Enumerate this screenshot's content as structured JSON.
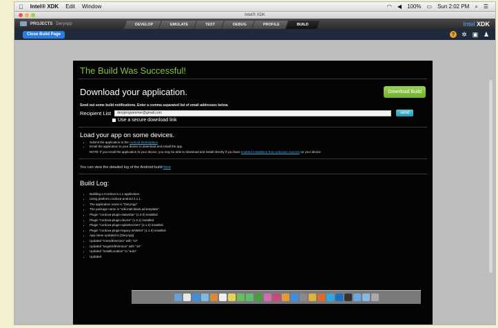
{
  "menubar": {
    "apple": "",
    "app_name": "Intel® XDK",
    "menu": [
      "Edit",
      "Window"
    ],
    "battery": "100%",
    "clock": "Sun 2:02 PM"
  },
  "window": {
    "title": "Intel® XDK"
  },
  "projects": {
    "label": "PROJECTS",
    "name": "DeryApp"
  },
  "tabs": [
    {
      "label": "DEVELOP"
    },
    {
      "label": "EMULATE"
    },
    {
      "label": "TEST"
    },
    {
      "label": "DEBUG"
    },
    {
      "label": "PROFILE"
    },
    {
      "label": "BUILD"
    }
  ],
  "brand": {
    "intel": "Intel",
    "xdk": "XDK"
  },
  "toolbar": {
    "close_label": "Close Build Page"
  },
  "build": {
    "success": "The Build Was Successful!",
    "download_title": "Download your application.",
    "download_button": "Download Build",
    "notify_text": "Send out some build notifications.  Enter a comma separated list of email addresses below.",
    "recipient_label": "Recipient List",
    "recipient_value": "deryprogrammer@gmail.com",
    "send_label": "send",
    "secure_label": "Use a secure download link",
    "load_title": "Load your app on some devices.",
    "step1_pre": "Submit the application to the ",
    "step1_link": "Android Marketplace",
    "step1_post": ".",
    "step2": "Email the application to your device to download and install the app.",
    "note_pre": "NOTE:  If you email the application to your device, you may be able to download and install directly if you have ",
    "note_link": "enabled installation from unknown sources",
    "note_post": " on your device.",
    "log_pre": "You can view the detailed log of the Android build ",
    "log_link": "here",
    "buildlog_title": "Build Log:",
    "log_items": [
      "Building a Cordova 5.1.1 application.",
      "Using platform cordova-android 4.1.1.",
      "The application name is \"DeryApp\"",
      "The package name is \"xdk.intel.blank.ad.template\"",
      "Plugin \"cordova-plugin-statusbar\" (1.0.0) installed.",
      "Plugin \"cordova-plugin-device\" (1.0.1) installed.",
      "Plugin \"cordova-plugin-splashscreen\" (2.1.0) installed.",
      "Plugin \"cordova-plugin-legacy-whitelist\" (1.1.0) installed.",
      "App name updated to [DeryApp]",
      "Updated \"minSdkVersion\" with \"14\"",
      "Updated \"targetSdkVersion\" with \"19\"",
      "Updated \"installLocation\" to \"auto\"",
      "Updated"
    ]
  },
  "colors": {
    "success_green": "#84c33e",
    "download_green": "#7ab834",
    "send_blue": "#3aa7c3",
    "close_blue": "#2e7be0",
    "brand_blue": "#5aa9ff"
  },
  "dock_icons": [
    "finder-icon",
    "launchpad-icon",
    "safari-icon",
    "mail-icon",
    "contacts-icon",
    "calendar-icon",
    "notes-icon",
    "maps-icon",
    "messages-icon",
    "facetime-icon",
    "photo-icon",
    "itunes-icon",
    "ibooks-icon",
    "appstore-icon",
    "preferences-icon",
    "chrome-icon",
    "firefox-icon",
    "skype-icon",
    "xdk-icon",
    "terminal-icon",
    "folder-icon",
    "downloads-icon",
    "trash-icon"
  ]
}
